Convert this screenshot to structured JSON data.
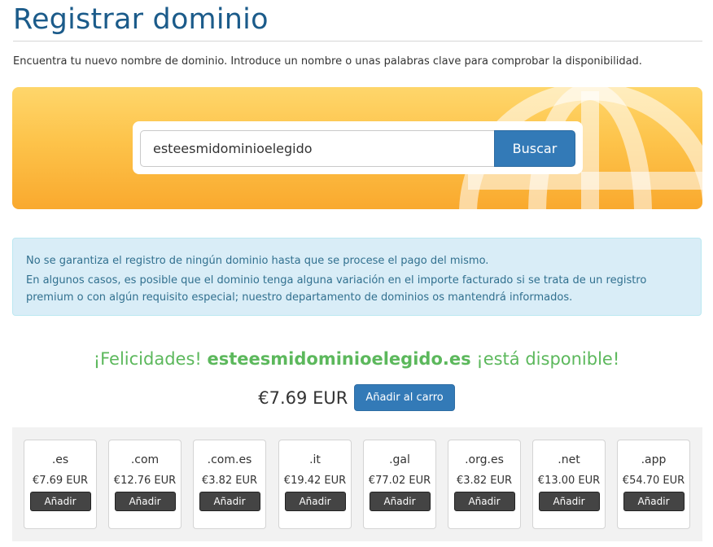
{
  "page": {
    "title": "Registrar dominio",
    "intro": "Encuentra tu nuevo nombre de dominio. Introduce un nombre o unas palabras clave para comprobar la disponibilidad."
  },
  "search": {
    "value": "esteesmidominioelegido",
    "button": "Buscar"
  },
  "alert": {
    "line1": "No se garantiza el registro de ningún dominio hasta que se procese el pago del mismo.",
    "line2": "En algunos casos, es posible que el dominio tenga alguna variación en el importe facturado si se trata de un registro premium o con algún requisito especial; nuestro departamento de dominios os mantendrá informados."
  },
  "result": {
    "prefix": "¡Felicidades!",
    "domain": "esteesmidominioelegido.es",
    "suffix": "¡está disponible!",
    "price": "€7.69 EUR",
    "cart_button": "Añadir al carro"
  },
  "suggestions": [
    {
      "tld": ".es",
      "price": "€7.69 EUR",
      "button": "Añadir"
    },
    {
      "tld": ".com",
      "price": "€12.76 EUR",
      "button": "Añadir"
    },
    {
      "tld": ".com.es",
      "price": "€3.82 EUR",
      "button": "Añadir"
    },
    {
      "tld": ".it",
      "price": "€19.42 EUR",
      "button": "Añadir"
    },
    {
      "tld": ".gal",
      "price": "€77.02 EUR",
      "button": "Añadir"
    },
    {
      "tld": ".org.es",
      "price": "€3.82 EUR",
      "button": "Añadir"
    },
    {
      "tld": ".net",
      "price": "€13.00 EUR",
      "button": "Añadir"
    },
    {
      "tld": ".app",
      "price": "€54.70 EUR",
      "button": "Añadir"
    }
  ],
  "colors": {
    "title": "#1b5b8a",
    "primary": "#337ab7",
    "success": "#5cb85c",
    "hero": "#fdc34a",
    "alert_bg": "#d9edf7",
    "alert_text": "#31708f"
  },
  "icons": {
    "hero_background": "globe-icon"
  }
}
